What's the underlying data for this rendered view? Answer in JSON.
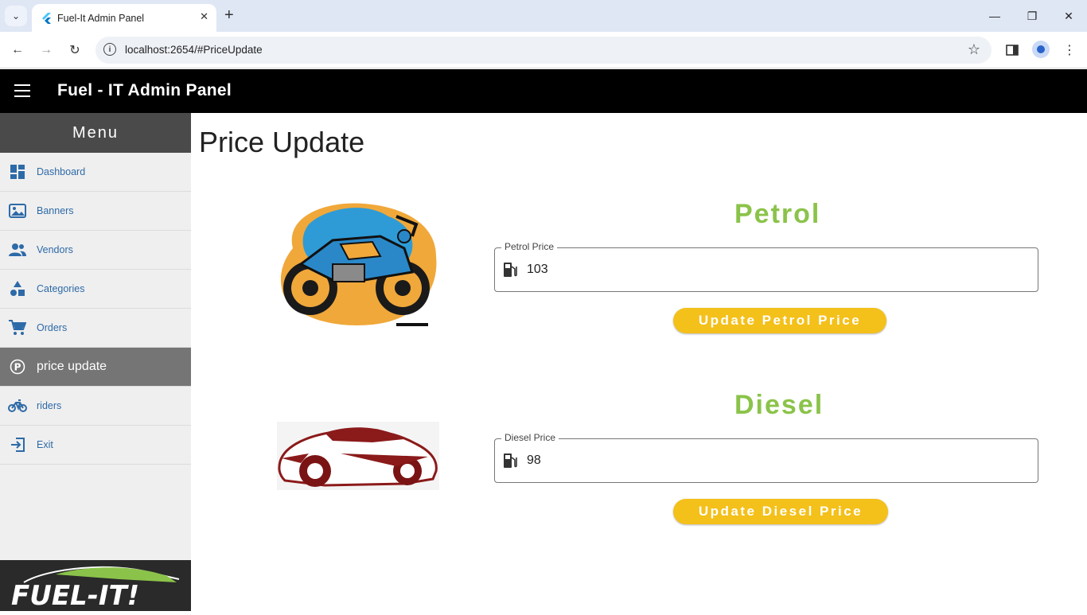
{
  "browser": {
    "tab_title": "Fuel-It Admin Panel",
    "url": "localhost:2654/#PriceUpdate"
  },
  "app": {
    "title": "Fuel - IT Admin Panel"
  },
  "sidebar": {
    "header": "Menu",
    "items": [
      {
        "label": "Dashboard",
        "icon": "dashboard-icon"
      },
      {
        "label": "Banners",
        "icon": "image-icon"
      },
      {
        "label": "Vendors",
        "icon": "people-icon"
      },
      {
        "label": "Categories",
        "icon": "category-icon"
      },
      {
        "label": "Orders",
        "icon": "cart-icon"
      },
      {
        "label": "price update",
        "icon": "currency-icon",
        "active": true
      },
      {
        "label": "riders",
        "icon": "bike-icon"
      },
      {
        "label": "Exit",
        "icon": "exit-icon"
      }
    ],
    "logo_text": "FUEL-IT!"
  },
  "page": {
    "title": "Price Update",
    "petrol": {
      "title": "Petrol",
      "field_label": "Petrol Price",
      "value": "103",
      "button": "Update Petrol Price"
    },
    "diesel": {
      "title": "Diesel",
      "field_label": "Diesel Price",
      "value": "98",
      "button": "Update Diesel Price"
    }
  },
  "colors": {
    "accent_green": "#8bc34a",
    "button_yellow": "#f4c01a",
    "link_blue": "#2d6aa8"
  }
}
